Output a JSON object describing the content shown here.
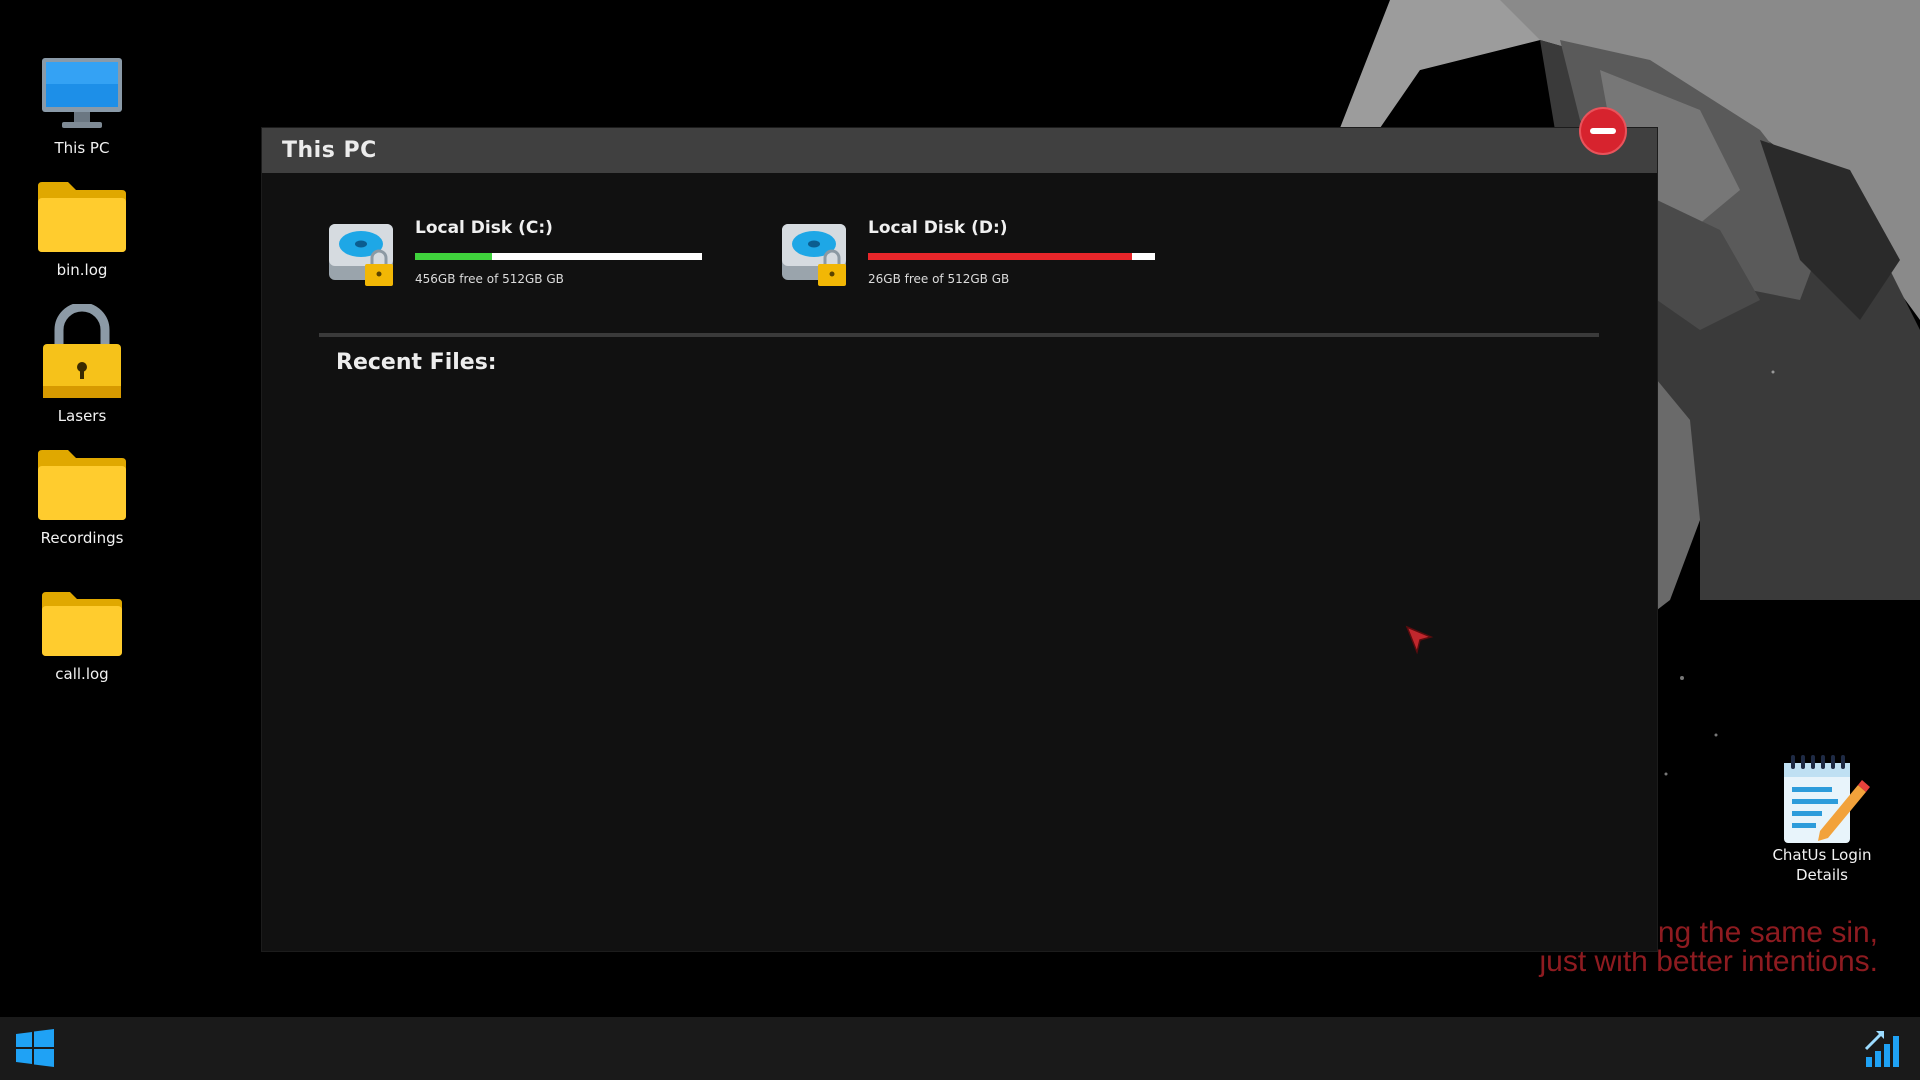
{
  "desktop": {
    "icons": [
      {
        "label": "This PC",
        "icon": "monitor-icon"
      },
      {
        "label": "bin.log",
        "icon": "folder-icon"
      },
      {
        "label": "Lasers",
        "icon": "padlock-icon"
      },
      {
        "label": "Recordings",
        "icon": "folder-icon"
      },
      {
        "label": "call.log",
        "icon": "folder-icon"
      },
      {
        "label": "ChatUs Login Details",
        "icon": "notepad-icon"
      }
    ],
    "wallpaper_text": "ng the same sin,\njust with better intentions."
  },
  "window": {
    "title": "This PC",
    "close_icon": "minus-circle-icon",
    "disks": [
      {
        "name": "Local Disk (C:)",
        "free_text": "456GB free of 512GB GB",
        "used_fraction": 0.27,
        "bar_color": "#3fd23c",
        "icon": "hard-drive-lock-icon"
      },
      {
        "name": "Local Disk (D:)",
        "free_text": "26GB free of 512GB GB",
        "used_fraction": 0.92,
        "bar_color": "#e8262a",
        "icon": "hard-drive-lock-icon"
      }
    ],
    "recent_files_label": "Recent Files:",
    "recent_files": []
  },
  "taskbar": {
    "start_icon": "windows-logo-icon",
    "tray_icon": "signal-bars-icon"
  },
  "colors": {
    "window_bg": "#111111",
    "titlebar_bg": "#404040",
    "close_red": "#d7232e",
    "taskbar_bg": "#1a1a1a",
    "wallpaper_text": "#8e1b20"
  }
}
